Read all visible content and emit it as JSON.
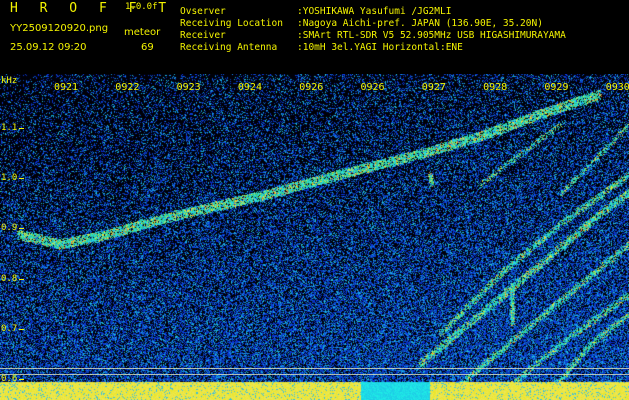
{
  "header": {
    "app_name": "H R O F F T",
    "version": "1.0.0f",
    "filename": "YY2509120920.png",
    "datetime": "25.09.12 09:20",
    "meteor_label": "meteor",
    "meteor_count": "69",
    "info": [
      {
        "key": "Ovserver",
        "value": ":YOSHIKAWA Yasufumi /JG2MLI"
      },
      {
        "key": "Receiving Location",
        "value": ":Nagoya Aichi-pref. JAPAN (136.90E, 35.20N)"
      },
      {
        "key": "Receiver",
        "value": ":SMArt RTL-SDR V5 52.905MHz USB HIGASHIMURAYAMA"
      },
      {
        "key": "Receiving Antenna",
        "value": ":10mH 3el.YAGI Horizontal:ENE"
      }
    ]
  },
  "chart_data": {
    "type": "heatmap",
    "ylabel": "kHz",
    "y_ticks": [
      "1.1",
      "1.0",
      "0.9",
      "0.8",
      "0.7",
      "0.6"
    ],
    "x_ticks": [
      "0921",
      "0922",
      "0923",
      "0924",
      "0926",
      "0926",
      "0927",
      "0928",
      "0929",
      "0930"
    ],
    "ylim": [
      0.58,
      1.2
    ],
    "colors": {
      "background": "#000010",
      "noise": "#1a3fd0",
      "signal": "#30d0e0",
      "strong": "#f0f040",
      "text": "#f4f400"
    }
  }
}
